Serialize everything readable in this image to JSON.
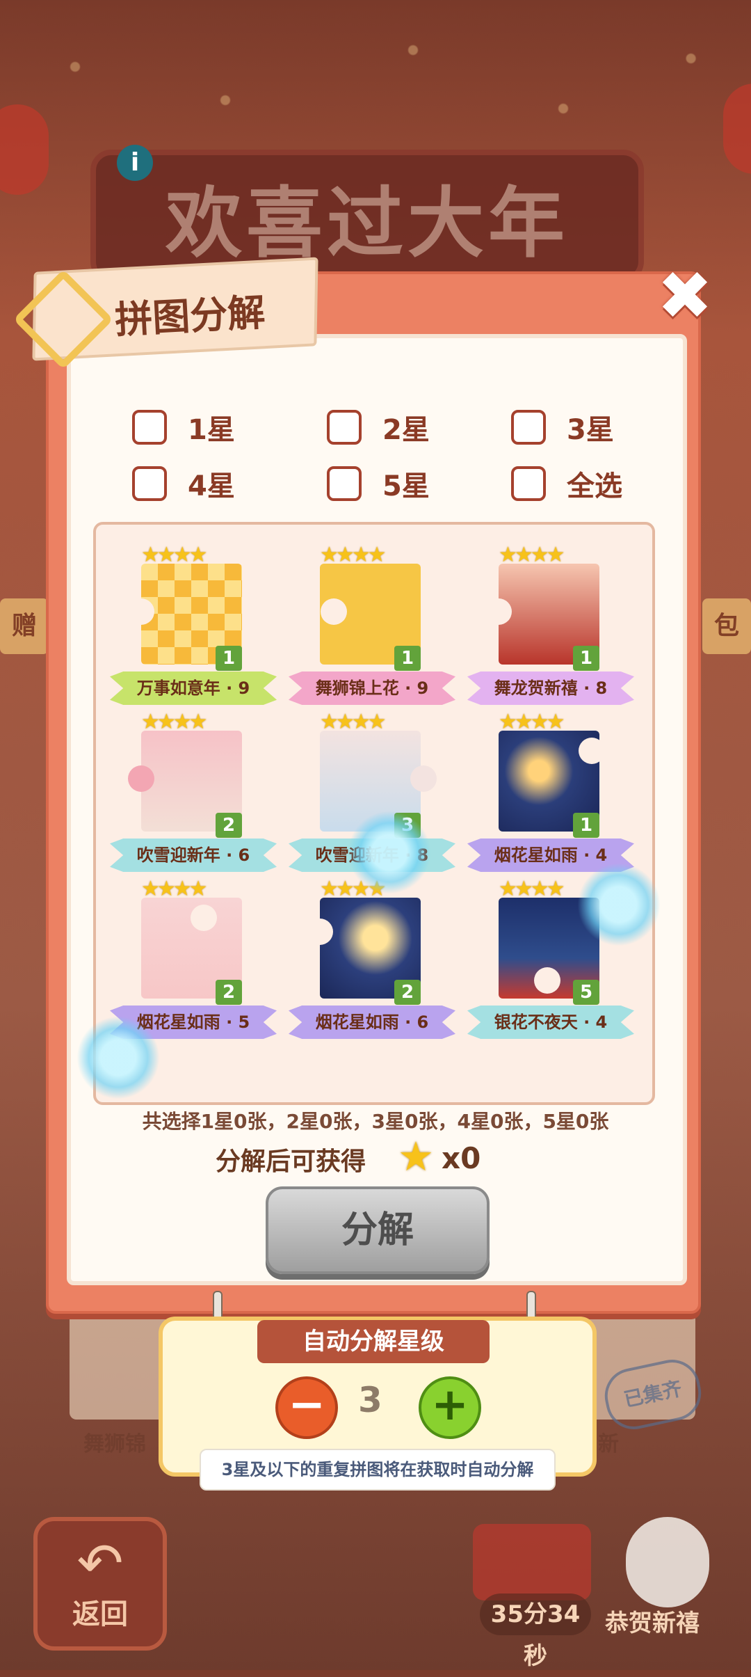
{
  "background": {
    "title_banner": "欢喜过大年",
    "info_icon": "i",
    "side_left": "赠",
    "side_right": "包",
    "bottom_left_card": "舞狮锦",
    "bottom_right_card": "新",
    "stamp": "已集齐",
    "back_label": "返回",
    "timer": "35分34秒",
    "event_label": "恭贺新禧"
  },
  "dialog": {
    "title": "拼图分解",
    "close_icon": "close-icon",
    "filters": [
      {
        "label": "1星",
        "checked": false
      },
      {
        "label": "2星",
        "checked": false
      },
      {
        "label": "3星",
        "checked": false
      },
      {
        "label": "4星",
        "checked": false
      },
      {
        "label": "5星",
        "checked": false
      },
      {
        "label": "全选",
        "checked": false
      }
    ],
    "cards": [
      {
        "name": "万事如意年 · 9",
        "stars": 4,
        "count": "1",
        "ribbon_color": "#c7e36a"
      },
      {
        "name": "舞狮锦上花 · 9",
        "stars": 4,
        "count": "1",
        "ribbon_color": "#f3a6c9"
      },
      {
        "name": "舞龙贺新禧 · 8",
        "stars": 4,
        "count": "1",
        "ribbon_color": "#e3b2f0"
      },
      {
        "name": "吹雪迎新年 · 6",
        "stars": 4,
        "count": "2",
        "ribbon_color": "#a4e0e2"
      },
      {
        "name": "吹雪迎新年 · 8",
        "stars": 4,
        "count": "3",
        "ribbon_color": "#a4e0e2"
      },
      {
        "name": "烟花星如雨 · 4",
        "stars": 4,
        "count": "1",
        "ribbon_color": "#b9a3ee"
      },
      {
        "name": "烟花星如雨 · 5",
        "stars": 4,
        "count": "2",
        "ribbon_color": "#b9a3ee"
      },
      {
        "name": "烟花星如雨 · 6",
        "stars": 4,
        "count": "2",
        "ribbon_color": "#b9a3ee"
      },
      {
        "name": "银花不夜天 · 4",
        "stars": 4,
        "count": "5",
        "ribbon_color": "#a4e0e2"
      }
    ],
    "summary": "共选择1星0张，2星0张，3星0张，4星0张，5星0张",
    "gain_label": "分解后可获得",
    "gain_value": "x0",
    "decompose_button": "分解"
  },
  "auto_panel": {
    "title": "自动分解星级",
    "minus": "−",
    "plus": "+",
    "level": "3",
    "note": "3星及以下的重复拼图将在获取时自动分解"
  }
}
